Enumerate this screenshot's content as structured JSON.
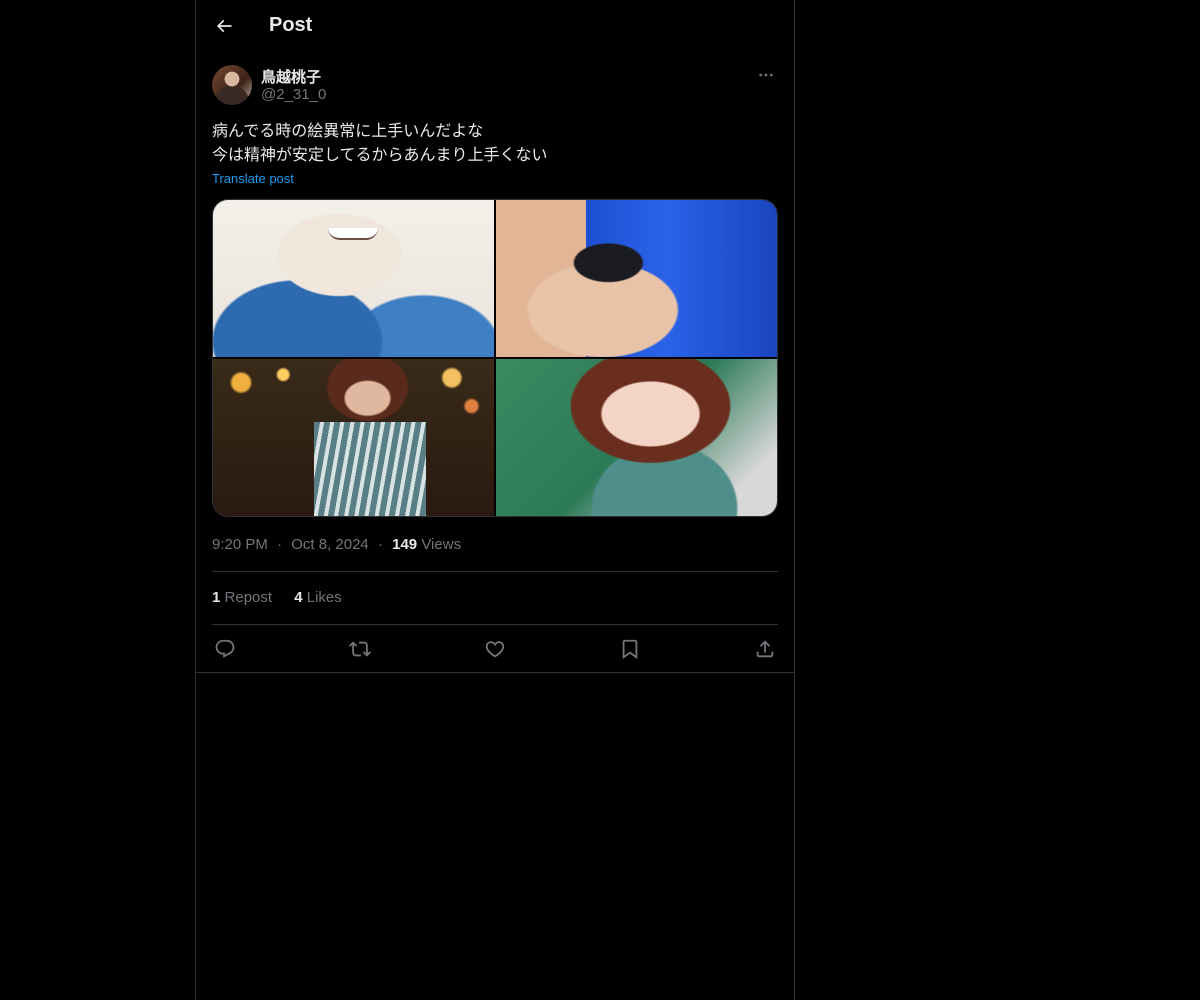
{
  "header": {
    "title": "Post",
    "back_icon": "arrow-left-icon"
  },
  "author": {
    "display_name": "鳥越桃子",
    "handle": "@2_31_0",
    "more_icon": "more-horizontal-icon"
  },
  "post": {
    "text_line1": "病んでる時の絵異常に上手いんだよな",
    "text_line2": "今は精神が安定してるからあんまり上手くない",
    "translate_label": "Translate post",
    "media_count": 4
  },
  "meta": {
    "time": "9:20 PM",
    "date": "Oct 8, 2024",
    "views_count": "149",
    "views_label": "Views",
    "dot": "·"
  },
  "stats": {
    "reposts_count": "1",
    "reposts_label": "Repost",
    "likes_count": "4",
    "likes_label": "Likes"
  },
  "actions": [
    "reply-icon",
    "repost-icon",
    "like-icon",
    "bookmark-icon",
    "share-icon"
  ],
  "colors": {
    "background": "#000000",
    "text": "#e7e9ea",
    "muted": "#71767b",
    "link": "#1d9bf0",
    "border": "#2f3336"
  }
}
